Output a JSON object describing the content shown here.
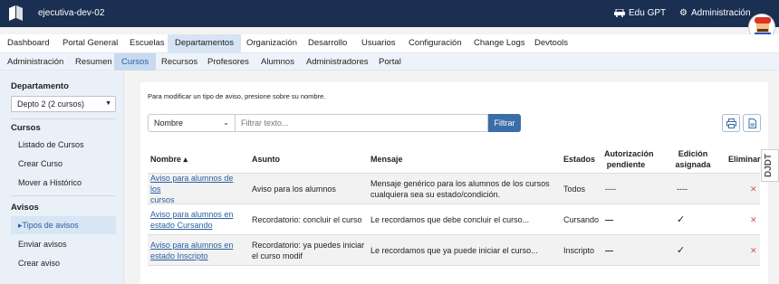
{
  "header": {
    "title": "ejecutiva-dev-02",
    "edu_gpt": "Edu GPT",
    "admin": "Administración"
  },
  "nav1": [
    "Dashboard",
    "Portal General",
    "Escuelas",
    "Departamentos",
    "Organización",
    "Desarrollo",
    "Usuarios",
    "Configuración",
    "Change Logs",
    "Devtools"
  ],
  "nav1_active": "Departamentos",
  "nav2": [
    "Administración",
    "Resumen",
    "Cursos",
    "Recursos",
    "Profesores",
    "Alumnos",
    "Administradores",
    "Portal"
  ],
  "nav2_active": "Cursos",
  "sidebar": {
    "departamento_heading": "Departamento",
    "departamento_value": "Depto 2 (2 cursos)",
    "cursos_heading": "Cursos",
    "cursos_items": [
      "Listado de Cursos",
      "Crear Curso",
      "Mover a Histórico"
    ],
    "avisos_heading": "Avisos",
    "avisos_items": [
      "Tipos de avisos",
      "Enviar avisos",
      "Crear aviso"
    ]
  },
  "main": {
    "hint": "Para modificar un tipo de aviso, presione sobre su nombre.",
    "filter_field": "Nombre",
    "filter_placeholder": "Filtrar texto...",
    "filter_button": "Filtrar",
    "columns": {
      "nombre": "Nombre",
      "asunto": "Asunto",
      "mensaje": "Mensaje",
      "estados": "Estados",
      "autorizacion_1": "Autorización",
      "autorizacion_2": "pendiente",
      "edicion_1": "Edición",
      "edicion_2": "asignada",
      "eliminar": "Eliminar"
    },
    "rows": [
      {
        "nombre_1": "Aviso para alumnos de los",
        "nombre_2": "cursos",
        "asunto_1": "Aviso para los alumnos",
        "asunto_2": "",
        "mensaje_1": "Mensaje genérico para los alumnos de los cursos",
        "mensaje_2": "cualquiera sea su estado/condición.",
        "estado": "Todos",
        "autorizacion": "----",
        "edicion": "----"
      },
      {
        "nombre_1": "Aviso para alumnos en",
        "nombre_2": "estado Cursando",
        "asunto_1": "Recordatorio: concluir el curso",
        "asunto_2": "",
        "mensaje_1": "Le recordamos que debe concluir el curso...",
        "mensaje_2": "",
        "estado": "Cursando",
        "autorizacion": "—",
        "edicion": "✓"
      },
      {
        "nombre_1": "Aviso para alumnos en",
        "nombre_2": "estado Inscripto",
        "asunto_1": "Recordatorio: ya puedes iniciar",
        "asunto_2": "el curso modif",
        "mensaje_1": "Le recordamos que ya puede iniciar el curso...",
        "mensaje_2": "",
        "estado": "Inscripto",
        "autorizacion": "—",
        "edicion": "✓"
      }
    ],
    "delete_glyph": "✕"
  },
  "side_tab": "DJDT"
}
